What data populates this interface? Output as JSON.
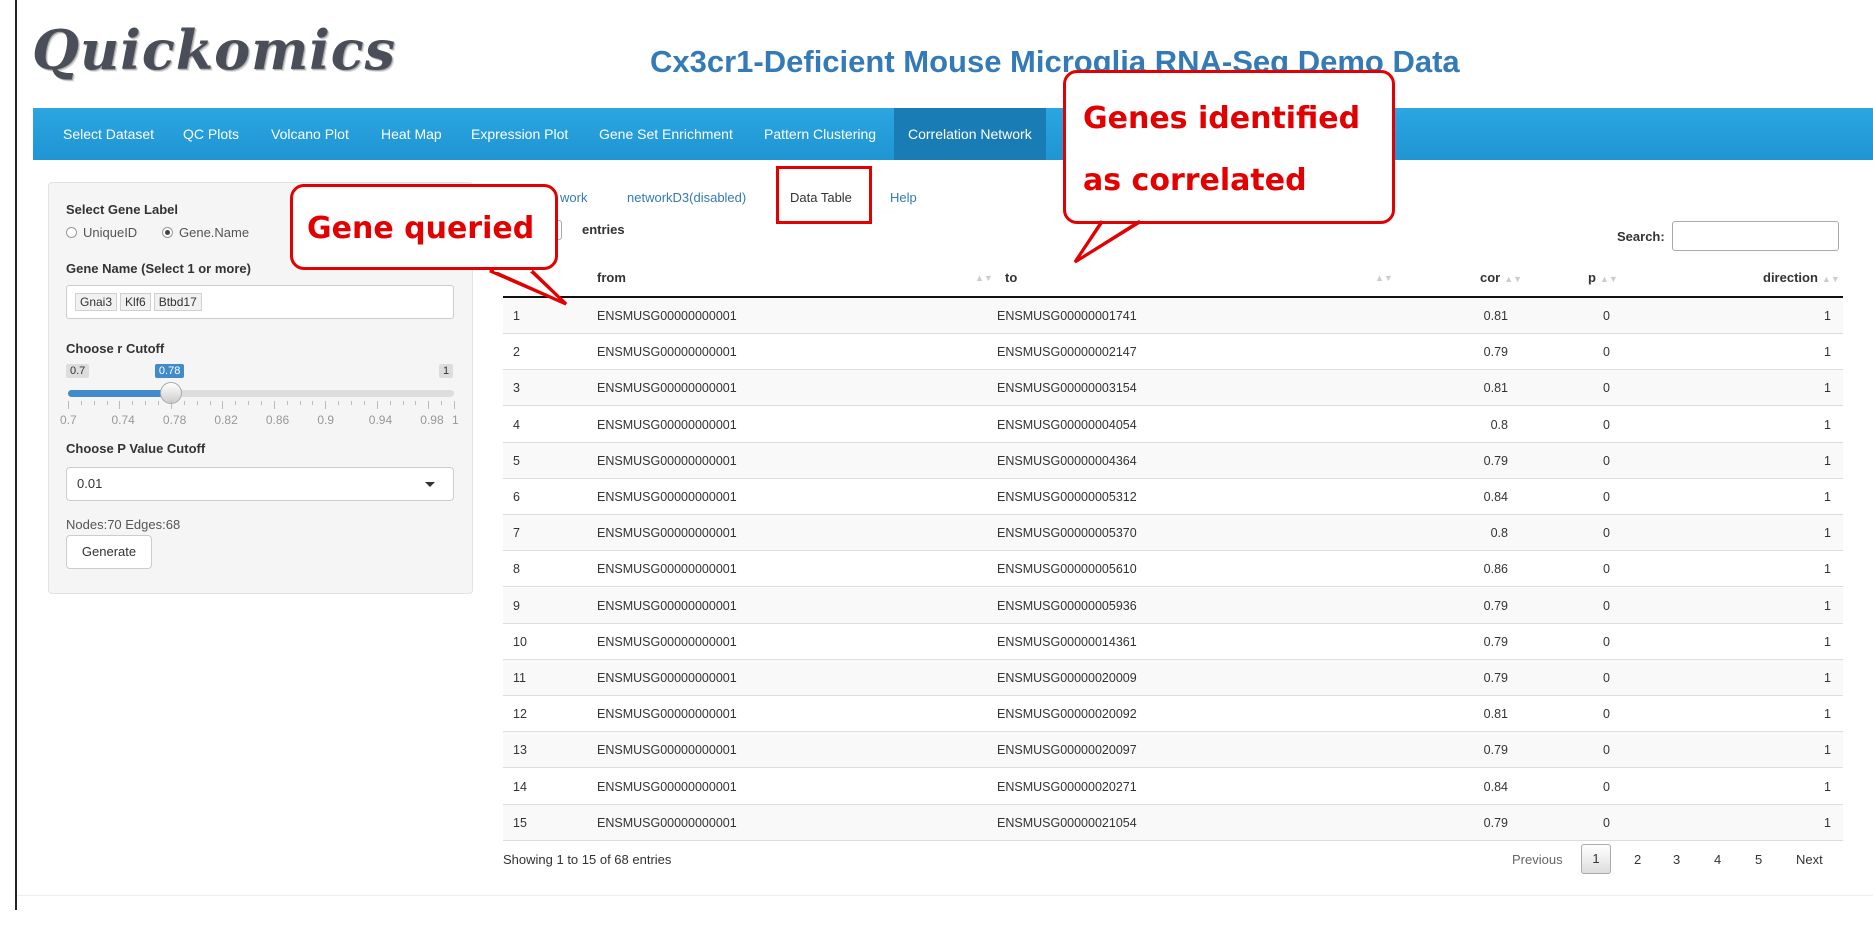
{
  "header": {
    "logo": "Quickomics",
    "title": "Cx3cr1-Deficient Mouse Microglia RNA-Seq Demo Data"
  },
  "navbar": {
    "items": [
      "Select Dataset",
      "QC Plots",
      "Volcano Plot",
      "Heat Map",
      "Expression Plot",
      "Gene Set Enrichment",
      "Pattern Clustering",
      "Correlation Network"
    ],
    "active": "Correlation Network"
  },
  "sidebar": {
    "gene_label_title": "Select Gene Label",
    "radio_options": [
      "UniqueID",
      "Gene.Name"
    ],
    "radio_selected": "Gene.Name",
    "gene_name_title": "Gene Name (Select 1 or more)",
    "genes": [
      "Gnai3",
      "Klf6",
      "Btbd17"
    ],
    "r_cutoff_title": "Choose r Cutoff",
    "slider": {
      "min_label": "0.7",
      "max_label": "1",
      "value_label": "0.78",
      "value": 0.78,
      "min": 0.7,
      "max": 1,
      "tick_labels": [
        "0.7",
        "0.74",
        "0.78",
        "0.82",
        "0.86",
        "0.9",
        "0.94",
        "0.98",
        "1"
      ]
    },
    "p_cutoff_title": "Choose P Value Cutoff",
    "p_cutoff_value": "0.01",
    "stats": "Nodes:70 Edges:68",
    "generate_label": "Generate"
  },
  "tabs": {
    "items": [
      "work",
      "networkD3(disabled)",
      "Data Table",
      "Help"
    ],
    "active": "Data Table"
  },
  "table": {
    "page_size": "5",
    "entries_label": "entries",
    "search_label": "Search:",
    "columns": [
      "from",
      "to",
      "cor",
      "p",
      "direction"
    ],
    "rows": [
      [
        "1",
        "ENSMUSG00000000001",
        "ENSMUSG00000001741",
        "0.81",
        "0",
        "1"
      ],
      [
        "2",
        "ENSMUSG00000000001",
        "ENSMUSG00000002147",
        "0.79",
        "0",
        "1"
      ],
      [
        "3",
        "ENSMUSG00000000001",
        "ENSMUSG00000003154",
        "0.81",
        "0",
        "1"
      ],
      [
        "4",
        "ENSMUSG00000000001",
        "ENSMUSG00000004054",
        "0.8",
        "0",
        "1"
      ],
      [
        "5",
        "ENSMUSG00000000001",
        "ENSMUSG00000004364",
        "0.79",
        "0",
        "1"
      ],
      [
        "6",
        "ENSMUSG00000000001",
        "ENSMUSG00000005312",
        "0.84",
        "0",
        "1"
      ],
      [
        "7",
        "ENSMUSG00000000001",
        "ENSMUSG00000005370",
        "0.8",
        "0",
        "1"
      ],
      [
        "8",
        "ENSMUSG00000000001",
        "ENSMUSG00000005610",
        "0.86",
        "0",
        "1"
      ],
      [
        "9",
        "ENSMUSG00000000001",
        "ENSMUSG00000005936",
        "0.79",
        "0",
        "1"
      ],
      [
        "10",
        "ENSMUSG00000000001",
        "ENSMUSG00000014361",
        "0.79",
        "0",
        "1"
      ],
      [
        "11",
        "ENSMUSG00000000001",
        "ENSMUSG00000020009",
        "0.79",
        "0",
        "1"
      ],
      [
        "12",
        "ENSMUSG00000000001",
        "ENSMUSG00000020092",
        "0.81",
        "0",
        "1"
      ],
      [
        "13",
        "ENSMUSG00000000001",
        "ENSMUSG00000020097",
        "0.79",
        "0",
        "1"
      ],
      [
        "14",
        "ENSMUSG00000000001",
        "ENSMUSG00000020271",
        "0.84",
        "0",
        "1"
      ],
      [
        "15",
        "ENSMUSG00000000001",
        "ENSMUSG00000021054",
        "0.79",
        "0",
        "1"
      ]
    ],
    "info": "Showing 1 to 15 of 68 entries",
    "pagination": {
      "previous": "Previous",
      "pages": [
        "1",
        "2",
        "3",
        "4",
        "5"
      ],
      "current": "1",
      "next": "Next"
    }
  },
  "annotations": {
    "gene_queried": "Gene queried",
    "correlated_line1": "Genes identified",
    "correlated_line2": "as correlated",
    "color": "#e30000"
  },
  "colors": {
    "navbar": "#2ba6e1",
    "nav_active": "#1a7cb4",
    "title": "#337ab7",
    "slider": "#428bca"
  }
}
